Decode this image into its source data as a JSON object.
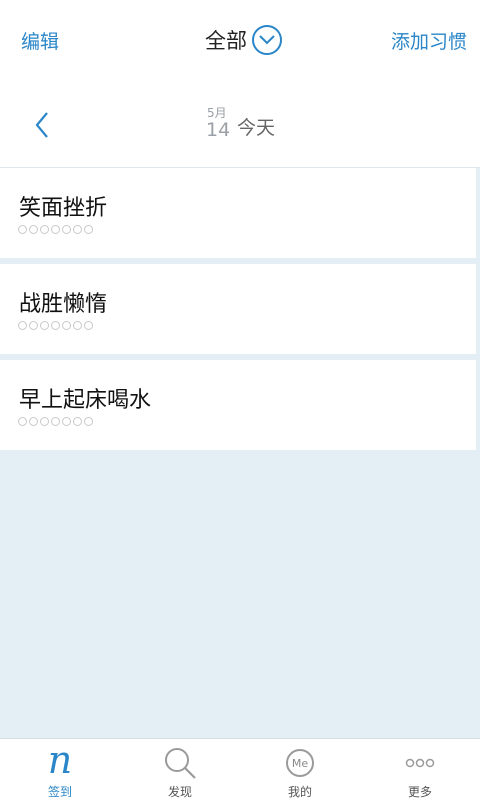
{
  "header": {
    "edit_label": "编辑",
    "filter_label": "全部",
    "add_label": "添加习惯"
  },
  "datebar": {
    "month": "5月",
    "day": "14",
    "label": "今天"
  },
  "habits": [
    {
      "title": "笑面挫折",
      "checks": 7
    },
    {
      "title": "战胜懒惰",
      "checks": 7
    },
    {
      "title": "早上起床喝水",
      "checks": 7
    }
  ],
  "tabbar": {
    "items": [
      {
        "label": "签到",
        "icon": "checkin-n-icon",
        "active": true
      },
      {
        "label": "发现",
        "icon": "search-icon",
        "active": false
      },
      {
        "label": "我的",
        "icon": "me-icon",
        "badge_text": "Me",
        "active": false
      },
      {
        "label": "更多",
        "icon": "more-icon",
        "active": false
      }
    ]
  },
  "colors": {
    "accent": "#2a86c8",
    "background": "#e3eef5"
  }
}
